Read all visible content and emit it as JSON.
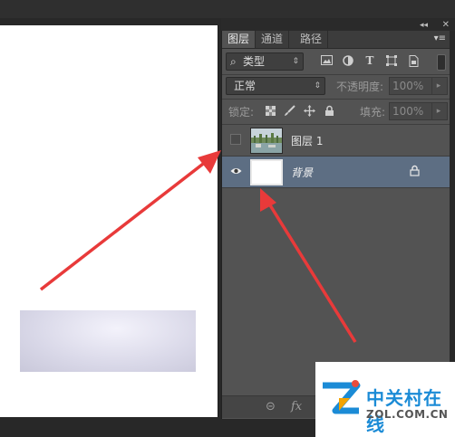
{
  "panel": {
    "collapse_glyph": "◂◂",
    "close_glyph": "✕",
    "menu_glyph": "▾≡",
    "tabs": [
      "图层",
      "通道",
      "路径"
    ]
  },
  "filter": {
    "kind_label": "类型",
    "search_glyph": "⌕"
  },
  "blend": {
    "mode": "正常",
    "opacity_label": "不透明度:",
    "opacity_value": "100%"
  },
  "lock": {
    "label": "锁定:",
    "fill_label": "填充:",
    "fill_value": "100%"
  },
  "layers": [
    {
      "name": "图层 1",
      "visible": false,
      "selected": false
    },
    {
      "name": "背景",
      "visible": true,
      "selected": true,
      "locked": true
    }
  ],
  "bottom_bar": {
    "link_glyph": "⊝",
    "fx_label": "fx"
  },
  "watermark": {
    "title": "中关村在线",
    "url": "ZOL.COM.CN"
  },
  "colors": {
    "arrow": "#e83a3a",
    "selected_layer": "#5d6e83",
    "panel_bg": "#535353"
  }
}
